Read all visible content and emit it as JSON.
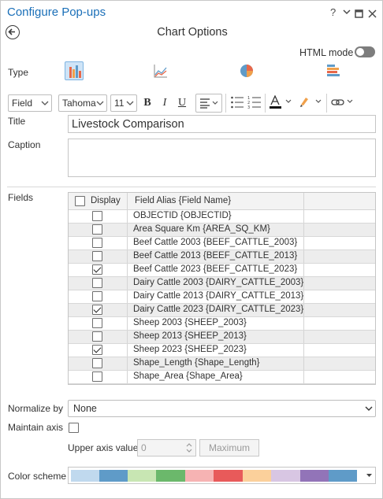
{
  "pane": {
    "title": "Configure Pop-ups",
    "help_label": "?",
    "menu_label": "⌄",
    "maximize_label": "□",
    "close_label": "✕"
  },
  "header": {
    "title": "Chart Options"
  },
  "html_mode": {
    "label": "HTML mode",
    "enabled": false
  },
  "type": {
    "label": "Type",
    "options": [
      {
        "name": "column-chart",
        "selected": true
      },
      {
        "name": "line-chart",
        "selected": false
      },
      {
        "name": "pie-chart",
        "selected": false
      },
      {
        "name": "bar-chart",
        "selected": false
      }
    ]
  },
  "toolbar": {
    "field_dropdown": "Field",
    "font_dropdown": "Tahoma",
    "size_dropdown": "11",
    "bold_label": "B",
    "italic_label": "I",
    "underline_label": "U"
  },
  "title_field": {
    "label": "Title",
    "value": "Livestock Comparison"
  },
  "caption_field": {
    "label": "Caption",
    "value": ""
  },
  "fields": {
    "label": "Fields",
    "header_display": "Display",
    "header_alias": "Field Alias {Field Name}",
    "rows": [
      {
        "alias": "OBJECTID {OBJECTID}",
        "checked": false
      },
      {
        "alias": "Area Square Km {AREA_SQ_KM}",
        "checked": false
      },
      {
        "alias": "Beef Cattle 2003 {BEEF_CATTLE_2003}",
        "checked": false
      },
      {
        "alias": "Beef Cattle 2013 {BEEF_CATTLE_2013}",
        "checked": false
      },
      {
        "alias": "Beef Cattle 2023 {BEEF_CATTLE_2023}",
        "checked": true
      },
      {
        "alias": "Dairy Cattle 2003 {DAIRY_CATTLE_2003}",
        "checked": false
      },
      {
        "alias": "Dairy Cattle 2013 {DAIRY_CATTLE_2013}",
        "checked": false
      },
      {
        "alias": "Dairy Cattle 2023 {DAIRY_CATTLE_2023}",
        "checked": true
      },
      {
        "alias": "Sheep 2003 {SHEEP_2003}",
        "checked": false
      },
      {
        "alias": "Sheep 2013 {SHEEP_2013}",
        "checked": false
      },
      {
        "alias": "Sheep 2023 {SHEEP_2023}",
        "checked": true
      },
      {
        "alias": "Shape_Length {Shape_Length}",
        "checked": false
      },
      {
        "alias": "Shape_Area {Shape_Area}",
        "checked": false
      }
    ]
  },
  "normalize": {
    "label": "Normalize by",
    "value": "None"
  },
  "maintain_axis": {
    "label": "Maintain axis",
    "checked": false
  },
  "upper_axis": {
    "label": "Upper axis value",
    "value": "0",
    "max_button": "Maximum"
  },
  "color_scheme": {
    "label": "Color scheme",
    "colors": [
      "#c0d9ee",
      "#5f9bc8",
      "#c8e6b3",
      "#6bb86b",
      "#f6b3b3",
      "#e85a5a",
      "#fbd09b",
      "#d8c6e3",
      "#9274b8",
      "#5f9bc8"
    ]
  }
}
